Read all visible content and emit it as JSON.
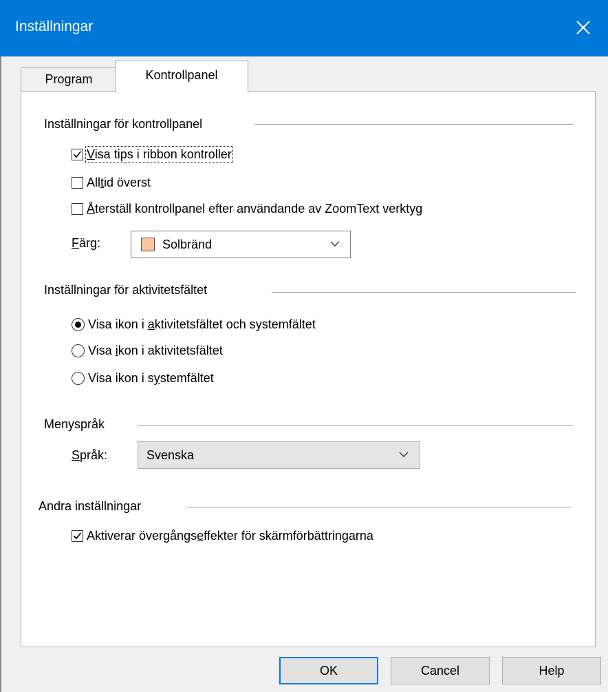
{
  "window": {
    "title": "Inställningar",
    "close_icon": "close-icon"
  },
  "tabs": [
    {
      "label": "Program",
      "active": false
    },
    {
      "label": "Kontrollpanel",
      "active": true
    }
  ],
  "kontrollpanel": {
    "heading": "Inställningar för kontrollpanel",
    "show_ribbon_tips": {
      "label_pre": "",
      "label_key": "V",
      "label_post": "isa tips i ribbon kontroller",
      "checked": true
    },
    "always_on_top": {
      "label_pre": "All",
      "label_key": "t",
      "label_post": "id överst",
      "checked": false
    },
    "reset_after_tool": {
      "label_pre": "",
      "label_key": "Å",
      "label_post": "terställ kontrollpanel efter användande av ZoomText verktyg",
      "checked": false
    },
    "color": {
      "label_pre": "",
      "label_key": "F",
      "label_post": "ärg:",
      "value": "Solbränd",
      "swatch": "#f8c79e"
    }
  },
  "taskbar": {
    "heading": "Inställningar för aktivitetsfältet",
    "options": [
      {
        "label_pre": "Visa ikon i ",
        "label_key": "a",
        "label_post": "ktivitetsfältet och systemfältet",
        "selected": true
      },
      {
        "label_pre": "Visa ",
        "label_key": "i",
        "label_post": "kon i aktivitetsfältet",
        "selected": false
      },
      {
        "label_pre": "Visa ikon i s",
        "label_key": "y",
        "label_post": "stemfältet",
        "selected": false
      }
    ]
  },
  "menu_language": {
    "heading": "Menyspråk",
    "label_pre": "",
    "label_key": "S",
    "label_post": "pråk:",
    "value": "Svenska"
  },
  "other": {
    "heading": "Andra inställningar",
    "transition_effects": {
      "label_pre": "Aktiverar övergångs",
      "label_key": "e",
      "label_post": "ffekter för skärmförbättringarna",
      "checked": true
    }
  },
  "buttons": {
    "ok": "OK",
    "cancel": "Cancel",
    "help": "Help"
  },
  "colors": {
    "titlebar": "#0078d7",
    "accent": "#0078d7"
  }
}
